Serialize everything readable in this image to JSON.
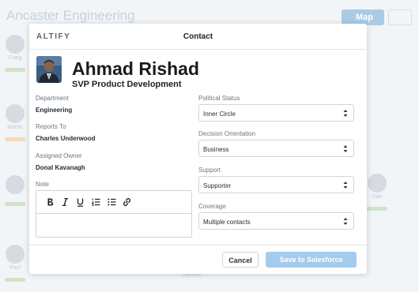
{
  "background": {
    "app_title": "Ancaster Engineering",
    "map_button_label": "Map",
    "cards": [
      {
        "name": "Craig"
      },
      {
        "name": "Martin"
      },
      {
        "name": "Paul"
      },
      {
        "name": "Dan"
      }
    ],
    "bottom_label": "Sahasa"
  },
  "modal": {
    "logo": "ALTIFY",
    "title": "Contact",
    "person": {
      "name": "Ahmad Rishad",
      "job_title": "SVP Product Development"
    },
    "left_fields": [
      {
        "label": "Department",
        "value": "Engineering"
      },
      {
        "label": "Reports To",
        "value": "Charles Underwood"
      },
      {
        "label": "Assigned Owner",
        "value": "Donal Kavanagh"
      }
    ],
    "note_label": "Note",
    "right_fields": [
      {
        "label": "Political Status",
        "value": "Inner Circle"
      },
      {
        "label": "Decision Orientation",
        "value": "Business"
      },
      {
        "label": "Support",
        "value": "Supporter"
      },
      {
        "label": "Coverage",
        "value": "Multiple contacts"
      }
    ],
    "cancel_label": "Cancel",
    "save_label": "Save to Salesforce"
  },
  "colors": {
    "save_button": "#a3cbee",
    "map_button": "#a9cbe6"
  }
}
